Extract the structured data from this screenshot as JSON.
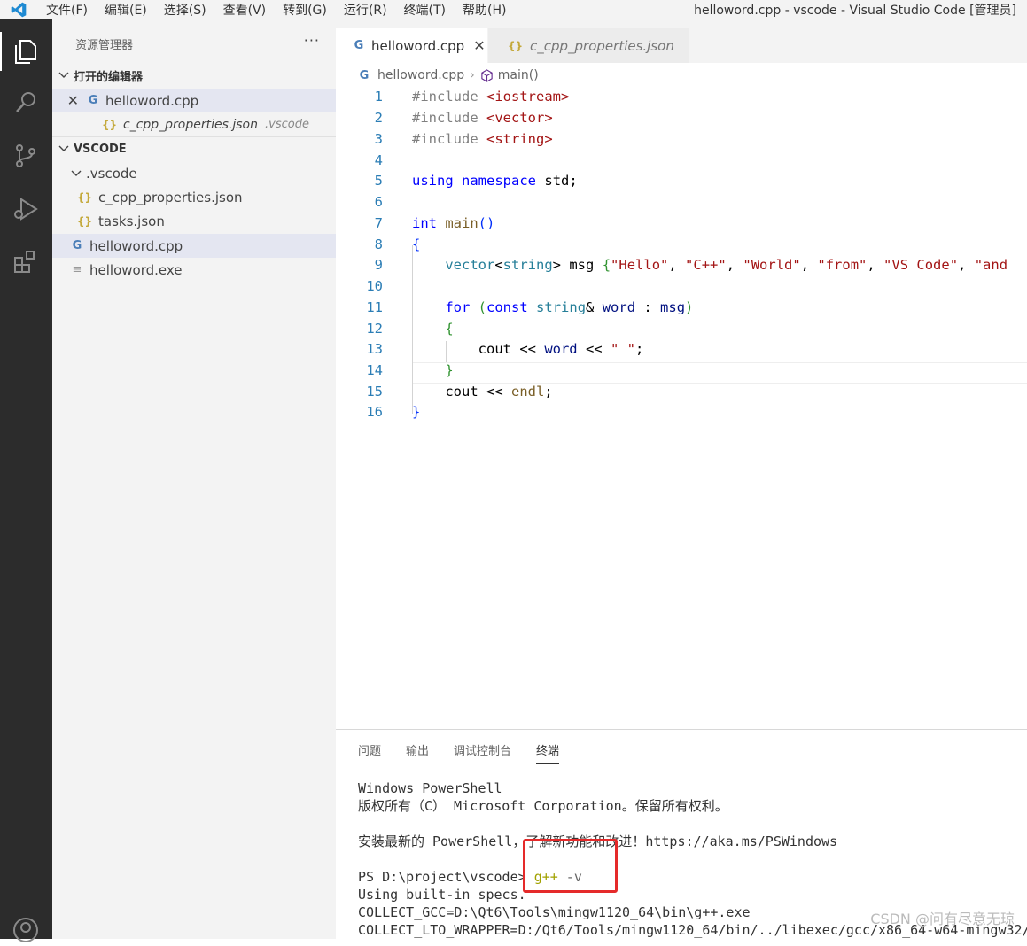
{
  "window": {
    "title": "helloword.cpp - vscode - Visual Studio Code [管理员]",
    "menu": [
      "文件(F)",
      "编辑(E)",
      "选择(S)",
      "查看(V)",
      "转到(G)",
      "运行(R)",
      "终端(T)",
      "帮助(H)"
    ]
  },
  "sidebar": {
    "title": "资源管理器",
    "more": "···",
    "open_editors_header": "打开的编辑器",
    "open_editors": [
      {
        "name": "helloword.cpp",
        "icon": "cpp-icon"
      },
      {
        "name": "c_cpp_properties.json",
        "folder": ".vscode",
        "icon": "json-icon"
      }
    ],
    "workspace_header": "VSCODE",
    "folder": ".vscode",
    "files": [
      {
        "name": "c_cpp_properties.json",
        "icon": "json-icon"
      },
      {
        "name": "tasks.json",
        "icon": "json-icon"
      },
      {
        "name": "helloword.cpp",
        "icon": "cpp-icon"
      },
      {
        "name": "helloword.exe",
        "icon": "exe-icon"
      }
    ]
  },
  "tabs": [
    {
      "label": "helloword.cpp",
      "active": true
    },
    {
      "label": "c_cpp_properties.json",
      "active": false
    }
  ],
  "breadcrumb": {
    "file": "helloword.cpp",
    "symbol": "main()"
  },
  "code": {
    "lines": [
      "#include <iostream>",
      "#include <vector>",
      "#include <string>",
      "",
      "using namespace std;",
      "",
      "int main()",
      "{",
      "    vector<string> msg {\"Hello\", \"C++\", \"World\", \"from\", \"VS Code\", \"and",
      "",
      "    for (const string& word : msg)",
      "    {",
      "        cout << word << \" \";",
      "    }",
      "    cout << endl;",
      "}"
    ]
  },
  "panel": {
    "tabs": [
      "问题",
      "输出",
      "调试控制台",
      "终端"
    ],
    "active_tab": "终端",
    "terminal": {
      "line1": "Windows PowerShell",
      "line2": "版权所有（C） Microsoft Corporation。保留所有权利。",
      "line3": "安装最新的 PowerShell，了解新功能和改进！https://aka.ms/PSWindows",
      "prompt": "PS D:\\project\\vscode> ",
      "cmd": "g++",
      "flag": " -v",
      "line5": "Using built-in specs.",
      "line6": "COLLECT_GCC=D:\\Qt6\\Tools\\mingw1120_64\\bin\\g++.exe",
      "line7": "COLLECT_LTO_WRAPPER=D:/Qt6/Tools/mingw1120_64/bin/../libexec/gcc/x86_64-w64-mingw32/"
    }
  },
  "watermark": "CSDN @问有尽意无琼"
}
